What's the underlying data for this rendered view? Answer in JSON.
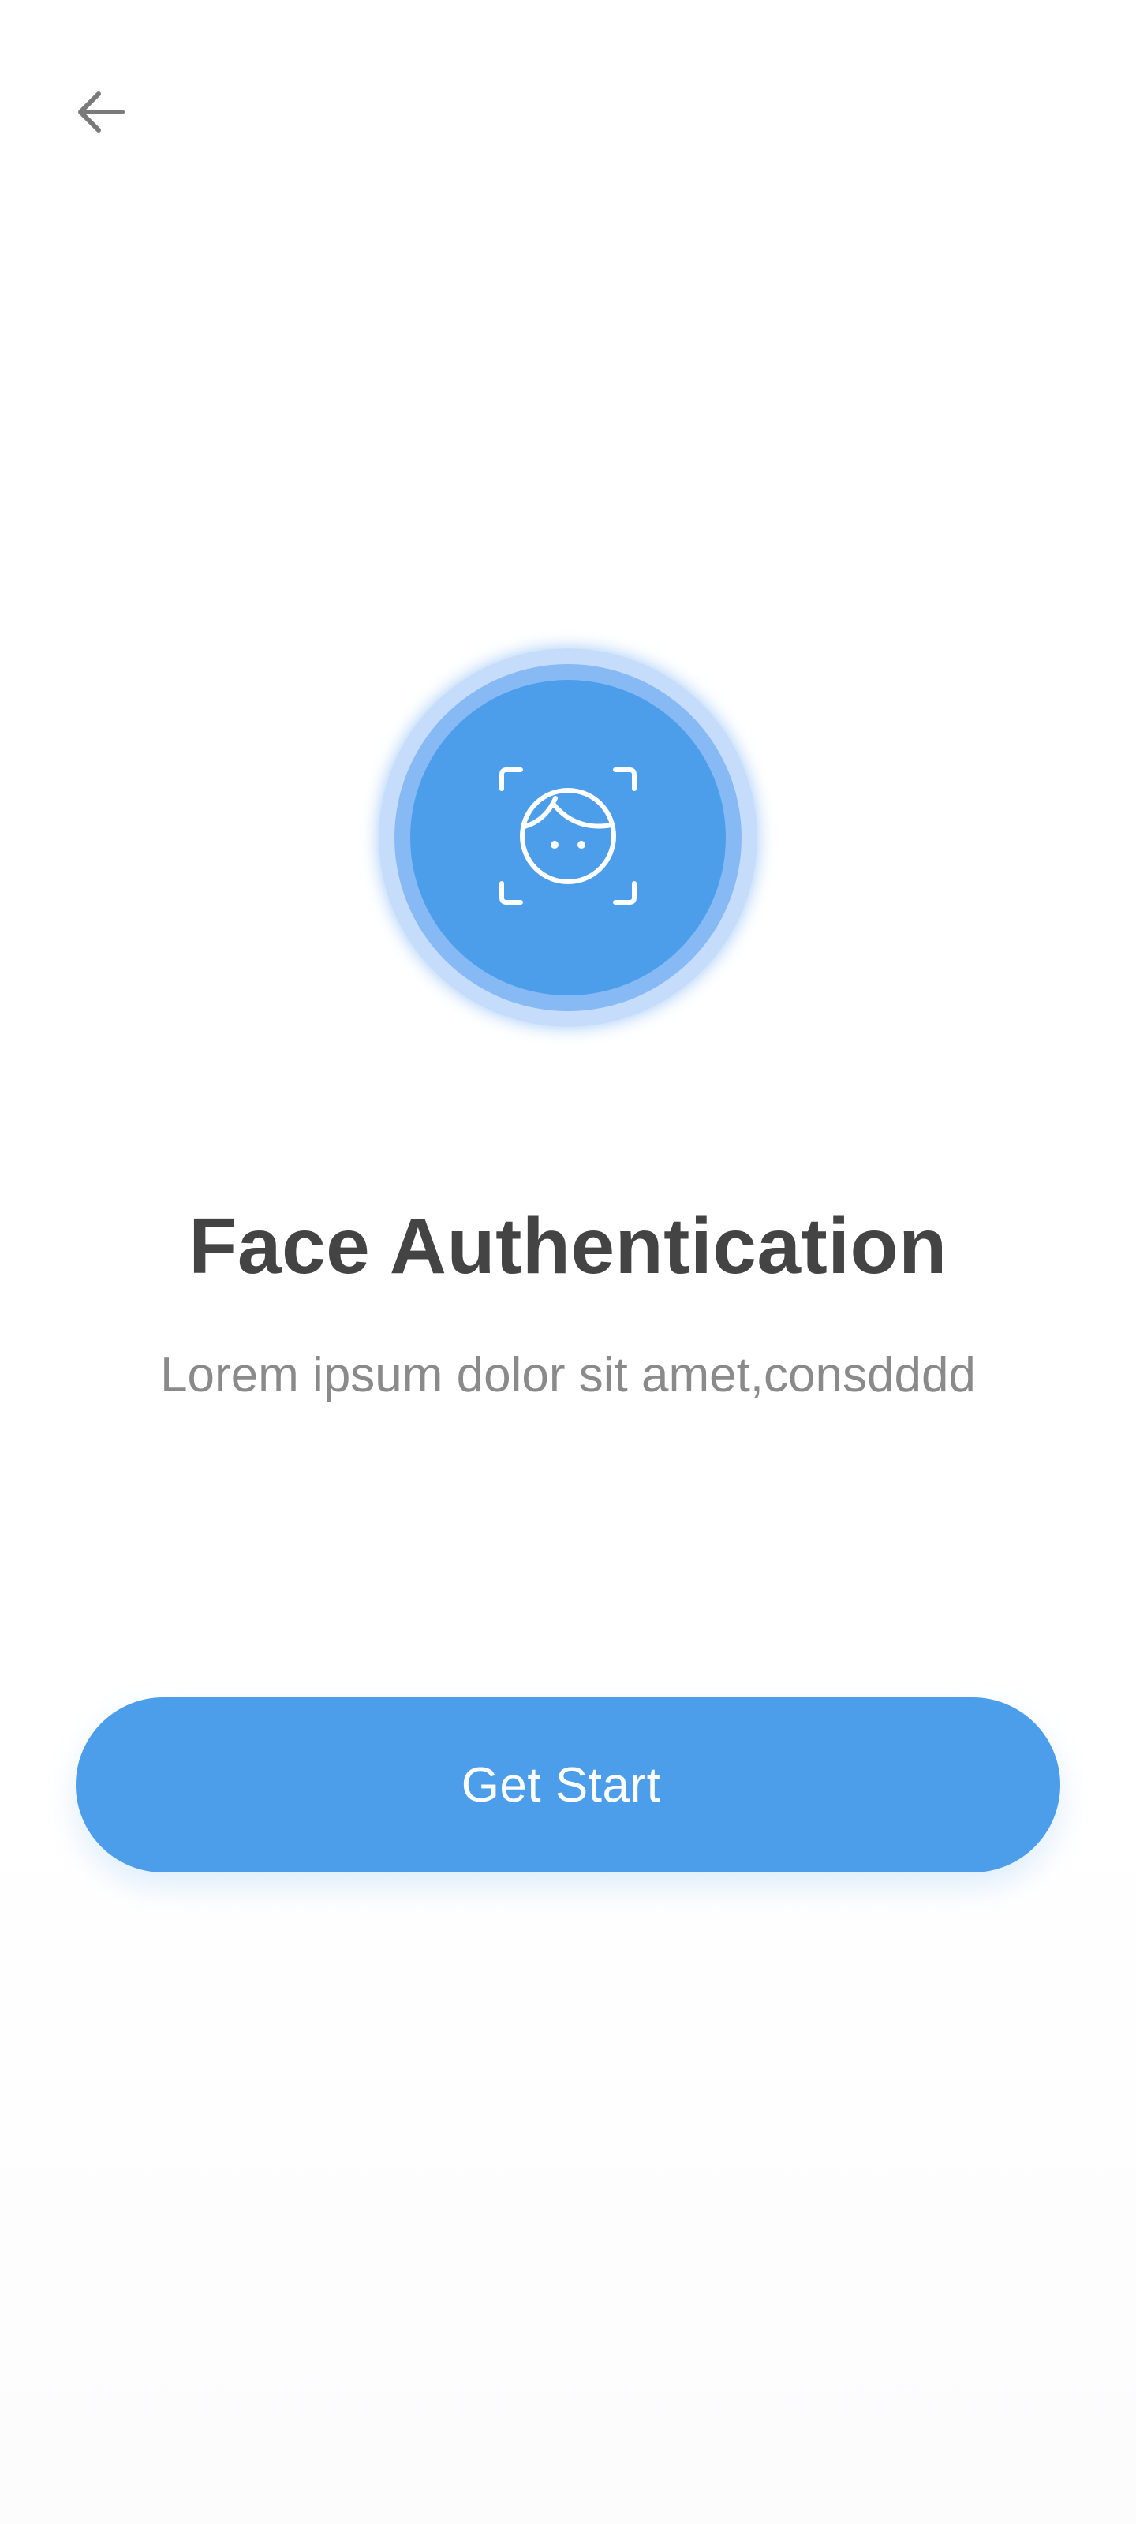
{
  "nav": {
    "back_icon": "arrow-left-icon"
  },
  "hero": {
    "icon": "face-scan-icon",
    "accent_color": "#4d9eea"
  },
  "content": {
    "title": "Face Authentication",
    "subtitle": "Lorem ipsum dolor sit amet,consdddd"
  },
  "actions": {
    "primary_label": "Get Start"
  },
  "colors": {
    "title": "#444444",
    "subtitle": "#8a8a8a",
    "button": "#4d9eea",
    "button_text": "#ffffff"
  }
}
